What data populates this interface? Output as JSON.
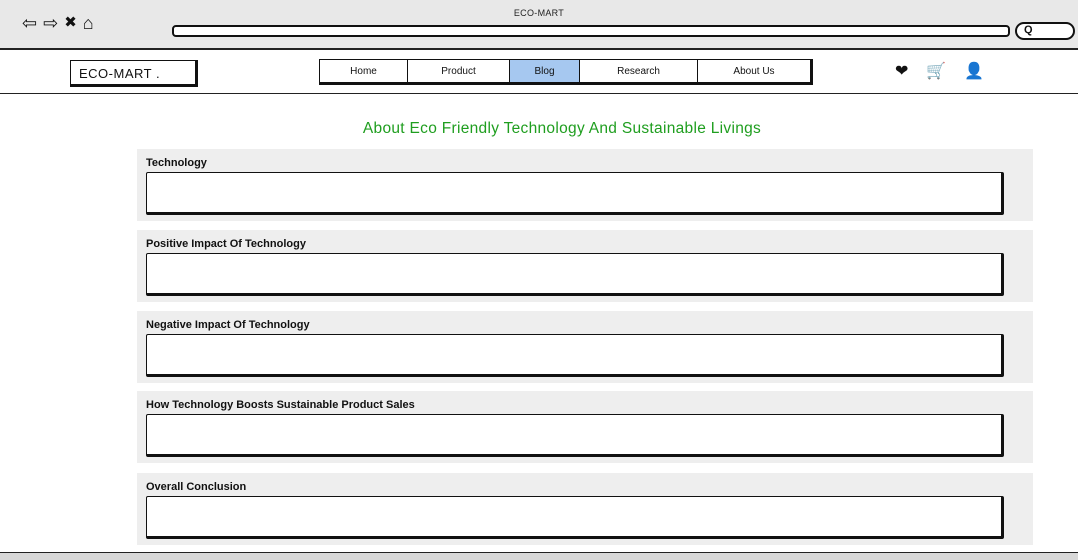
{
  "window": {
    "title": "ECO-MART",
    "nav_icons": {
      "back": "⇦",
      "forward": "⇨",
      "close": "✖",
      "home": "⌂"
    },
    "search_glyph": "Q"
  },
  "header": {
    "logo": "ECO-MART .",
    "menu": [
      {
        "label": "Home",
        "active": false
      },
      {
        "label": "Product",
        "active": false
      },
      {
        "label": "Blog",
        "active": true
      },
      {
        "label": "Research",
        "active": false
      },
      {
        "label": "About Us",
        "active": false
      }
    ],
    "icons": {
      "heart": "❤",
      "cart": "🛒",
      "user": "👤"
    }
  },
  "main": {
    "title": "About Eco Friendly Technology And Sustainable Livings",
    "sections": [
      {
        "label": "Technology"
      },
      {
        "label": "Positive Impact Of Technology"
      },
      {
        "label": "Negative Impact Of Technology"
      },
      {
        "label": " How Technology Boosts Sustainable Product Sales"
      },
      {
        "label": "Overall Conclusion"
      }
    ]
  },
  "colors": {
    "accent_title": "#1f9e1f",
    "active_tab": "#a6c8f0",
    "section_bg": "#eeeeee"
  }
}
